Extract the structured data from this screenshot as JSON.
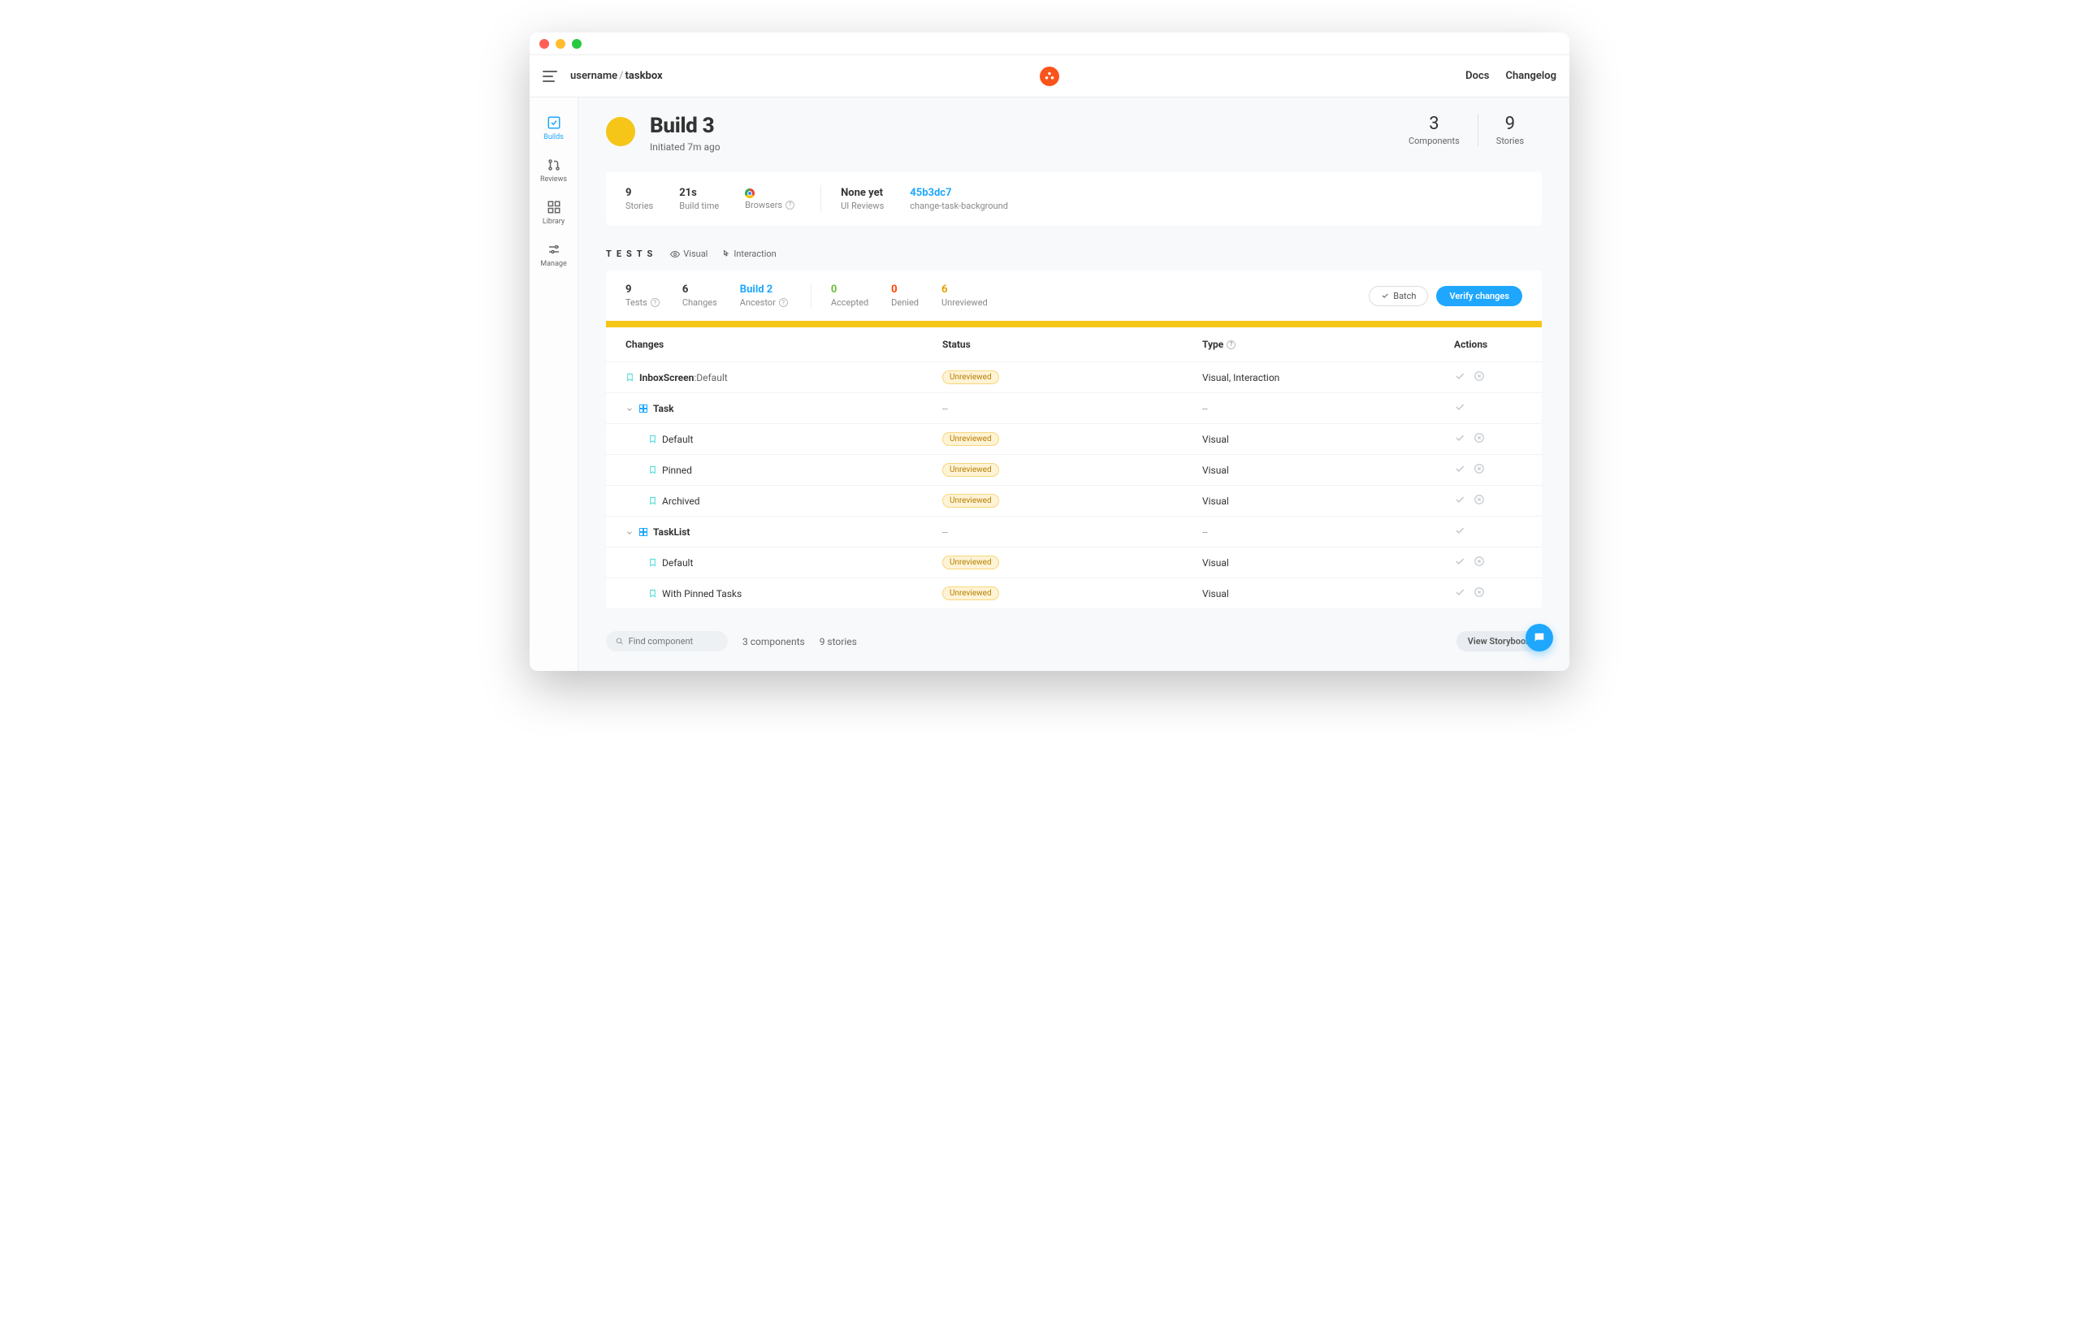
{
  "topbar": {
    "breadcrumb_user": "username",
    "breadcrumb_repo": "taskbox",
    "docs": "Docs",
    "changelog": "Changelog"
  },
  "sidebar": {
    "builds": "Builds",
    "reviews": "Reviews",
    "library": "Library",
    "manage": "Manage"
  },
  "header": {
    "title": "Build 3",
    "subtitle": "Initiated 7m ago",
    "components_num": "3",
    "components_lbl": "Components",
    "stories_num": "9",
    "stories_lbl": "Stories"
  },
  "infobar": {
    "stories_val": "9",
    "stories_lbl": "Stories",
    "buildtime_val": "21s",
    "buildtime_lbl": "Build time",
    "browsers_lbl": "Browsers",
    "uireviews_val": "None yet",
    "uireviews_lbl": "UI Reviews",
    "commit_val": "45b3dc7",
    "branch_lbl": "change-task-background"
  },
  "tests_filters": {
    "label": "TESTS",
    "visual": "Visual",
    "interaction": "Interaction"
  },
  "panel": {
    "tests_val": "9",
    "tests_lbl": "Tests",
    "changes_val": "6",
    "changes_lbl": "Changes",
    "ancestor_val": "Build 2",
    "ancestor_lbl": "Ancestor",
    "accepted_val": "0",
    "accepted_lbl": "Accepted",
    "denied_val": "0",
    "denied_lbl": "Denied",
    "unreviewed_val": "6",
    "unreviewed_lbl": "Unreviewed",
    "batch_btn": "Batch",
    "verify_btn": "Verify changes"
  },
  "table": {
    "h_changes": "Changes",
    "h_status": "Status",
    "h_type": "Type",
    "h_actions": "Actions",
    "rows": [
      {
        "kind": "story",
        "indent": 0,
        "comp": "InboxScreen",
        "sep": ":",
        "name": "Default",
        "status": "Unreviewed",
        "type": "Visual, Interaction",
        "hasDeny": true
      },
      {
        "kind": "component",
        "indent": 0,
        "name": "Task",
        "status": "--",
        "type": "--",
        "hasDeny": false
      },
      {
        "kind": "story",
        "indent": 2,
        "name": "Default",
        "status": "Unreviewed",
        "type": "Visual",
        "hasDeny": true
      },
      {
        "kind": "story",
        "indent": 2,
        "name": "Pinned",
        "status": "Unreviewed",
        "type": "Visual",
        "hasDeny": true
      },
      {
        "kind": "story",
        "indent": 2,
        "name": "Archived",
        "status": "Unreviewed",
        "type": "Visual",
        "hasDeny": true
      },
      {
        "kind": "component",
        "indent": 0,
        "name": "TaskList",
        "status": "--",
        "type": "--",
        "hasDeny": false
      },
      {
        "kind": "story",
        "indent": 2,
        "name": "Default",
        "status": "Unreviewed",
        "type": "Visual",
        "hasDeny": true
      },
      {
        "kind": "story",
        "indent": 2,
        "name": "With Pinned Tasks",
        "status": "Unreviewed",
        "type": "Visual",
        "hasDeny": true
      }
    ]
  },
  "footer": {
    "search_placeholder": "Find component",
    "components": "3 components",
    "stories": "9 stories",
    "view_storybook": "View Storybook"
  }
}
